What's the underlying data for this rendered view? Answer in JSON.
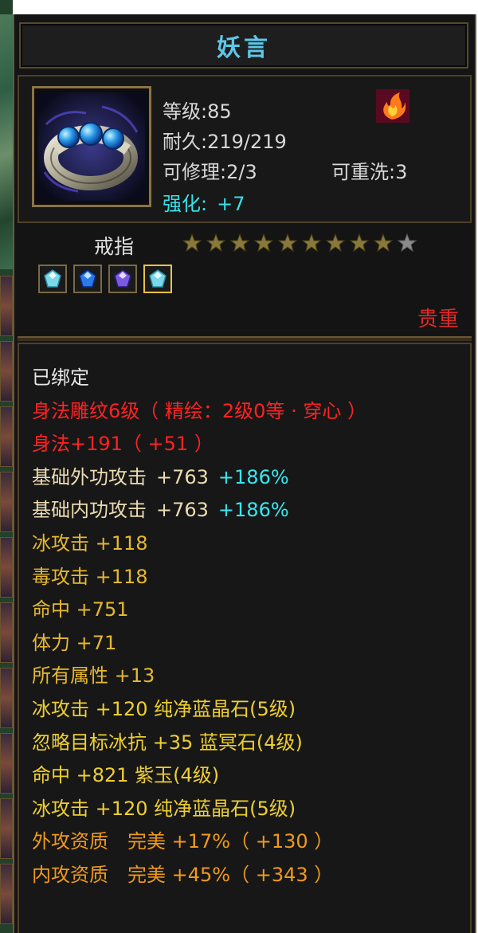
{
  "item": {
    "name": "妖言",
    "level": "等级:85",
    "durability": "耐久:219/219",
    "repairable": "可修理:2/3",
    "rewashable": "可重洗:3",
    "enhance_label": "强化:",
    "enhance_value": "+7",
    "icon": "silver-ring-with-blue-gems-icon",
    "badge_icon": "fire-element-icon",
    "type": "戒指",
    "stars_total": 9,
    "stars_filled": 8,
    "rarity": "贵重",
    "gem_slots": [
      {
        "icon": "diamond-gem-icon",
        "highlight": false
      },
      {
        "icon": "blue-crystal-gem-icon",
        "highlight": false
      },
      {
        "icon": "purple-jade-gem-icon",
        "highlight": false
      },
      {
        "icon": "diamond-gem-icon",
        "highlight": true
      }
    ]
  },
  "attributes": {
    "bound": "已绑定",
    "carving": "身法雕纹6级（ 精绘：2级0等 · 穿心 ）",
    "agility": "身法+191（ +51 ）",
    "ext_attack_label": "基础外功攻击",
    "ext_attack_value": "+763",
    "ext_attack_pct": "+186%",
    "int_attack_label": "基础内功攻击",
    "int_attack_value": "+763",
    "int_attack_pct": "+186%",
    "ice_attack": "冰攻击 +118",
    "poison_attack": "毒攻击 +118",
    "hit": "命中 +751",
    "stamina": "体力 +71",
    "all_attrs": "所有属性 +13",
    "gem1": "冰攻击 +120 纯净蓝晶石(5级)",
    "gem2": "忽略目标冰抗 +35 蓝冥石(4级)",
    "gem3": "命中 +821 紫玉(4级)",
    "gem4": "冰攻击 +120 纯净蓝晶石(5级)",
    "ext_quality": "外攻资质　完美 +17%（ +130 ）",
    "int_quality": "内攻资质　完美 +45%（ +343 ）"
  },
  "colors": {
    "title": "#5cc8e8",
    "enhance": "#36e0e8",
    "red": "#ff2222",
    "yellow": "#eecf30",
    "cyan": "#38e8f0",
    "orange": "#f09a1a",
    "rarity": "#e02828"
  }
}
